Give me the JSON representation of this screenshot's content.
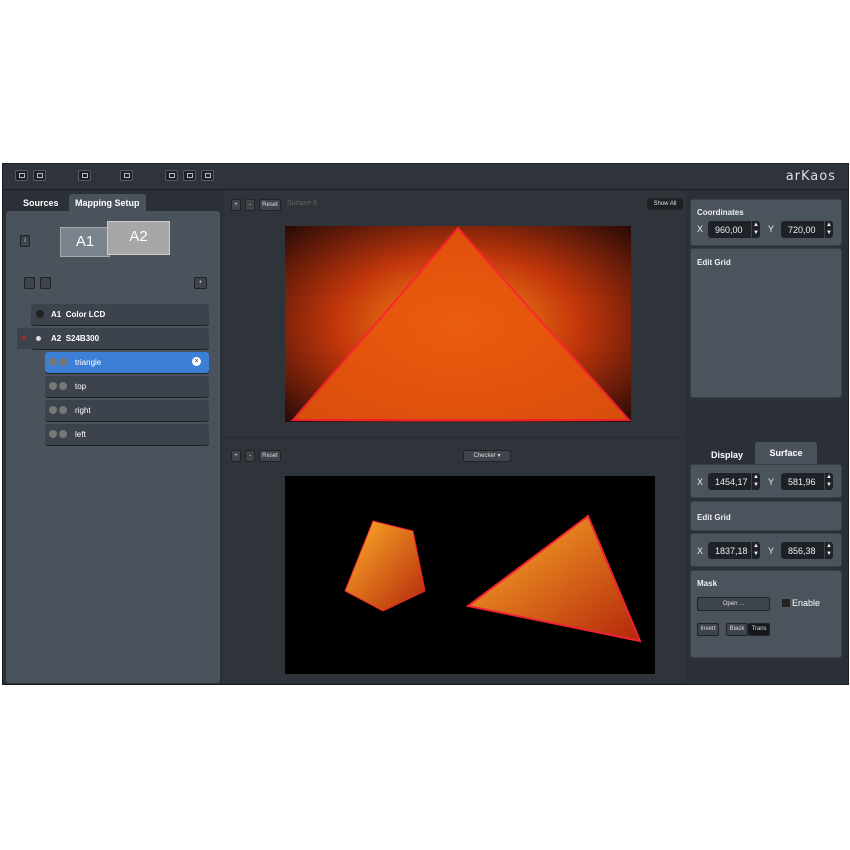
{
  "app": {
    "logo": "arKaos"
  },
  "left": {
    "tabs": [
      "Sources",
      "Mapping Setup"
    ],
    "outputs": [
      "A1",
      "A2"
    ],
    "rows": [
      {
        "id": "A1",
        "name": "Color LCD"
      },
      {
        "id": "A2",
        "name": "S24B300"
      }
    ],
    "surfaces": [
      "triangle",
      "top",
      "right",
      "left"
    ]
  },
  "top_view": {
    "plus": "+",
    "minus": "-",
    "reset": "Reset",
    "surface_label": "Surface 8",
    "show_all": "Show All"
  },
  "bottom_view": {
    "plus": "+",
    "minus": "-",
    "reset": "Reset",
    "mode": "Checker"
  },
  "right_top": {
    "coordinates": "Coordinates",
    "x_label": "X",
    "x": "960,00",
    "y_label": "Y",
    "y": "720,00",
    "edit_grid": "Edit Grid"
  },
  "right_bottom": {
    "tabs": [
      "Display",
      "Surface"
    ],
    "x_label": "X",
    "x1": "1454,17",
    "y_label": "Y",
    "y1": "581,96",
    "edit_grid": "Edit Grid",
    "x2": "1837,18",
    "y2": "856,38",
    "mask": "Mask",
    "open": "Open ...",
    "enable": "Enable",
    "invert": "Invert",
    "black": "Black",
    "trans": "Trans"
  },
  "colors": {
    "accent": "#3d7fd6",
    "bg": "#2b3038",
    "panel": "#4a525c"
  }
}
